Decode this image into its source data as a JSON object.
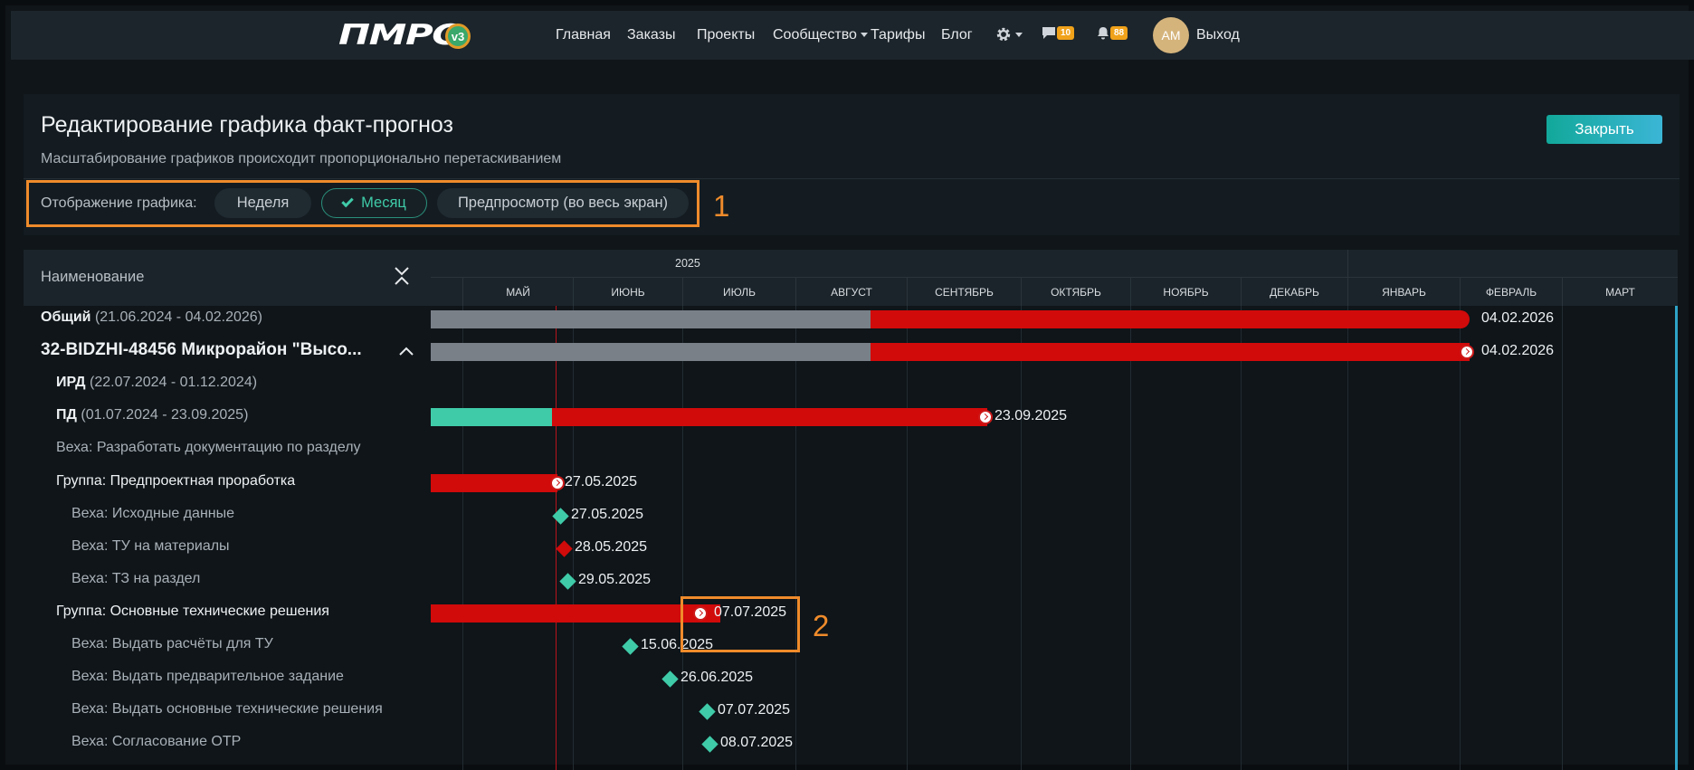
{
  "header": {
    "logo_text": "ПМРС",
    "logo_badge": "v3",
    "nav": [
      "Главная",
      "Заказы",
      "Проекты",
      "Сообщество",
      "Тарифы",
      "Блог"
    ],
    "messages_count": "10",
    "notifications_count": "88",
    "avatar_initials": "AM",
    "logout": "Выход"
  },
  "panel": {
    "title": "Редактирование графика факт-прогноз",
    "subtitle": "Масштабирование графиков происходит пропорционально перетаскиванием",
    "close_label": "Закрыть",
    "view_label": "Отображение графика:",
    "view_week": "Неделя",
    "view_month": "Месяц",
    "view_fullscreen": "Предпросмотр (во весь экран)"
  },
  "annotations": {
    "one": "1",
    "two": "2"
  },
  "gantt": {
    "name_header": "Наименование",
    "year": "2025",
    "months": [
      "МАЙ",
      "ИЮНЬ",
      "ИЮЛЬ",
      "АВГУСТ",
      "СЕНТЯБРЬ",
      "ОКТЯБРЬ",
      "НОЯБРЬ",
      "ДЕКАБРЬ",
      "ЯНВАРЬ",
      "ФЕВРАЛЬ",
      "МАРТ"
    ],
    "rows": [
      {
        "name": "Общий",
        "range": "(21.06.2024 - 04.02.2026)",
        "date": "04.02.2026"
      },
      {
        "name": "32-BIDZHI-48456 Микрорайон \"Высо...",
        "date": "04.02.2026"
      },
      {
        "name": "ИРД",
        "range": "(22.07.2024 - 01.12.2024)"
      },
      {
        "name": "ПД",
        "range": "(01.07.2024 - 23.09.2025)",
        "date": "23.09.2025"
      },
      {
        "name": "Веха: Разработать документацию по разделу"
      },
      {
        "name": "Группа: Предпроектная проработка",
        "date": "27.05.2025"
      },
      {
        "name": "Веха: Исходные данные",
        "date": "27.05.2025"
      },
      {
        "name": "Веха: ТУ на материалы",
        "date": "28.05.2025"
      },
      {
        "name": "Веха: ТЗ на раздел",
        "date": "29.05.2025"
      },
      {
        "name": "Группа: Основные технические решения",
        "date": "07.07.2025"
      },
      {
        "name": "Веха: Выдать расчёты для ТУ",
        "date": "15.06.2025"
      },
      {
        "name": "Веха: Выдать предварительное задание",
        "date": "26.06.2025"
      },
      {
        "name": "Веха: Выдать основные технические решения",
        "date": "07.07.2025"
      },
      {
        "name": "Веха: Согласование ОТР",
        "date": "08.07.2025"
      }
    ]
  },
  "colors": {
    "overdue": "#d10a0a",
    "done": "#7a8088",
    "progress": "#3fcba8",
    "accent": "#ef8b2b"
  }
}
